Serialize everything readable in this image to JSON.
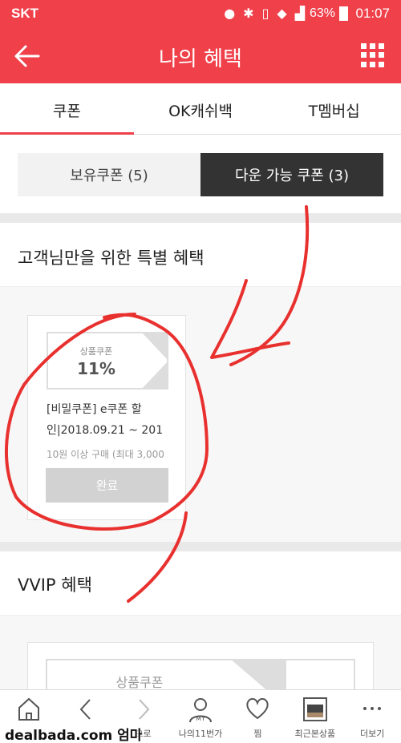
{
  "status_bar": {
    "carrier": "SKT",
    "battery": "63%",
    "time": "01:07"
  },
  "header": {
    "title": "나의 혜택",
    "back_icon": "arrow-left-icon",
    "menu_icon": "grid-menu-icon"
  },
  "tabs": [
    {
      "label": "쿠폰",
      "active": true
    },
    {
      "label": "OK캐쉬백",
      "active": false
    },
    {
      "label": "T멤버십",
      "active": false
    }
  ],
  "segments": [
    {
      "label": "보유쿠폰 (5)",
      "active": false
    },
    {
      "label": "다운 가능 쿠폰 (3)",
      "active": true
    }
  ],
  "section_special": {
    "title": "고객님만을 위한 특별 혜택",
    "coupon": {
      "kind": "상품쿠폰",
      "rate": "11%",
      "name_line1": "[비밀쿠폰] e쿠폰 할",
      "name_line2": "인|2018.09.21 ~ 201",
      "condition": "10원 이상 구매 (최대 3,000",
      "button": "완료"
    }
  },
  "section_vvip": {
    "title": "VVIP 혜택",
    "coupon": {
      "kind": "상품쿠폰"
    }
  },
  "bottom_nav": [
    {
      "icon": "home-icon",
      "label": ""
    },
    {
      "icon": "chevron-left-icon",
      "label": ""
    },
    {
      "icon": "chevron-right-icon",
      "label": "으로"
    },
    {
      "icon": "my-page-icon",
      "label": "나의11번가"
    },
    {
      "icon": "heart-icon",
      "label": "찜"
    },
    {
      "icon": "recent-product-icon",
      "label": "최근본상품"
    },
    {
      "icon": "more-dots-icon",
      "label": "더보기"
    }
  ],
  "watermark": "dealbada.com 엄마",
  "colors": {
    "brand": "#f0404a",
    "segment_active": "#333333",
    "annotation": "#e8312f"
  }
}
